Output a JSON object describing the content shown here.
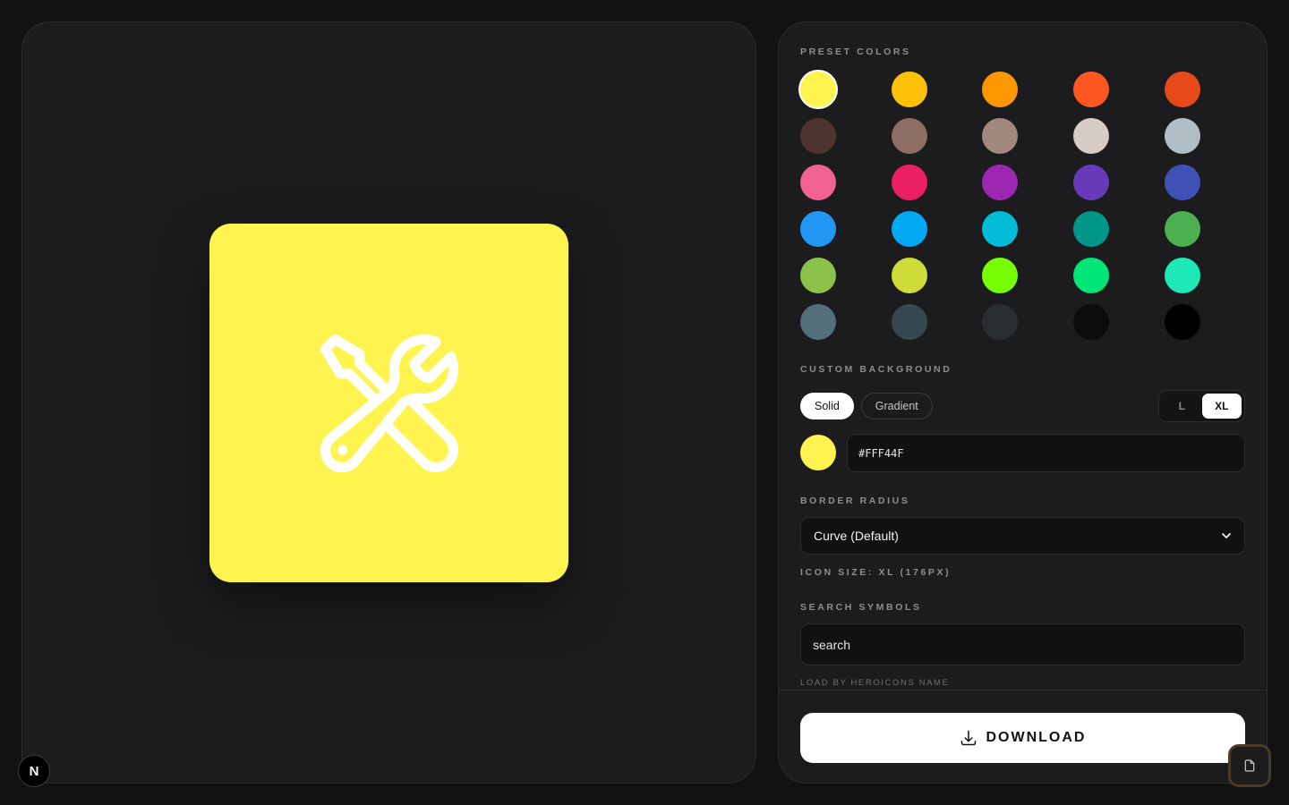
{
  "preview": {
    "background_color": "#FFF44F",
    "icon_name": "wrench-screwdriver-icon"
  },
  "settings": {
    "preset_colors_label": "PRESET COLORS",
    "preset_colors": [
      "#FFF44F",
      "#FFC107",
      "#FF9800",
      "#FF5722",
      "#E64A19",
      "#4E342E",
      "#8D6E63",
      "#A1887F",
      "#D7CCC8",
      "#B0BEC5",
      "#F06292",
      "#E91E63",
      "#9C27B0",
      "#673AB7",
      "#3F51B5",
      "#2196F3",
      "#03A9F4",
      "#00BCD4",
      "#009688",
      "#4CAF50",
      "#8BC34A",
      "#CDDC39",
      "#76FF03",
      "#00E676",
      "#1DE9B6",
      "#546E7A",
      "#37474F",
      "#2B2E30",
      "#0B0B0B",
      "#000000"
    ],
    "selected_color_index": 0,
    "custom_background_label": "CUSTOM BACKGROUND",
    "bg_modes": [
      "Solid",
      "Gradient"
    ],
    "active_bg_mode": "Solid",
    "sizes": [
      "L",
      "XL"
    ],
    "active_size": "XL",
    "hex_value": "#FFF44F",
    "border_radius_label": "BORDER RADIUS",
    "border_radius_value": "Curve (Default)",
    "icon_size_text": "ICON SIZE: XL (176PX)",
    "search_label": "SEARCH SYMBOLS",
    "search_value": "search",
    "search_hint": "LOAD BY HEROICONS NAME",
    "download_label": "DOWNLOAD"
  },
  "next_badge": "N"
}
